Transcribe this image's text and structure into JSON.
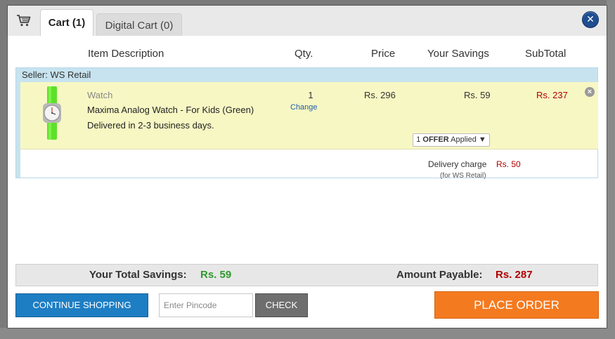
{
  "tabs": {
    "cart_label": "Cart (1)",
    "digital_label": "Digital Cart (0)"
  },
  "close_glyph": "✕",
  "columns": {
    "description": "Item Description",
    "qty": "Qty.",
    "price": "Price",
    "savings": "Your Savings",
    "subtotal": "SubTotal"
  },
  "seller": {
    "label": "Seller: WS Retail",
    "item": {
      "category": "Watch",
      "name": "Maxima Analog Watch - For Kids (Green)",
      "delivery": "Delivered in 2-3 business days.",
      "qty": "1",
      "change_label": "Change",
      "price": "Rs. 296",
      "savings": "Rs. 59",
      "subtotal": "Rs. 237",
      "offer_count": "1",
      "offer_word": "OFFER",
      "offer_rest": "Applied ▼",
      "remove_glyph": "×"
    },
    "delivery_charge": {
      "label": "Delivery charge",
      "sub": "(for WS Retail)",
      "value": "Rs. 50"
    }
  },
  "totals": {
    "savings_label": "Your Total Savings:",
    "savings_value": "Rs. 59",
    "payable_label": "Amount Payable:",
    "payable_value": "Rs. 287"
  },
  "actions": {
    "continue_label": "CONTINUE SHOPPING",
    "pincode_placeholder": "Enter Pincode",
    "check_label": "CHECK",
    "place_order_label": "PLACE ORDER"
  },
  "colors": {
    "accent_blue": "#1e7ec3",
    "place_order_orange": "#f47a1f",
    "savings_green": "#2e9a2e",
    "price_red": "#b10000",
    "item_row_bg": "#f7f7c4",
    "seller_bar_bg": "#c7e3ef"
  },
  "icons": {
    "cart": "cart-icon",
    "close": "close-icon",
    "remove": "remove-item-icon",
    "product": "watch-thumbnail"
  }
}
